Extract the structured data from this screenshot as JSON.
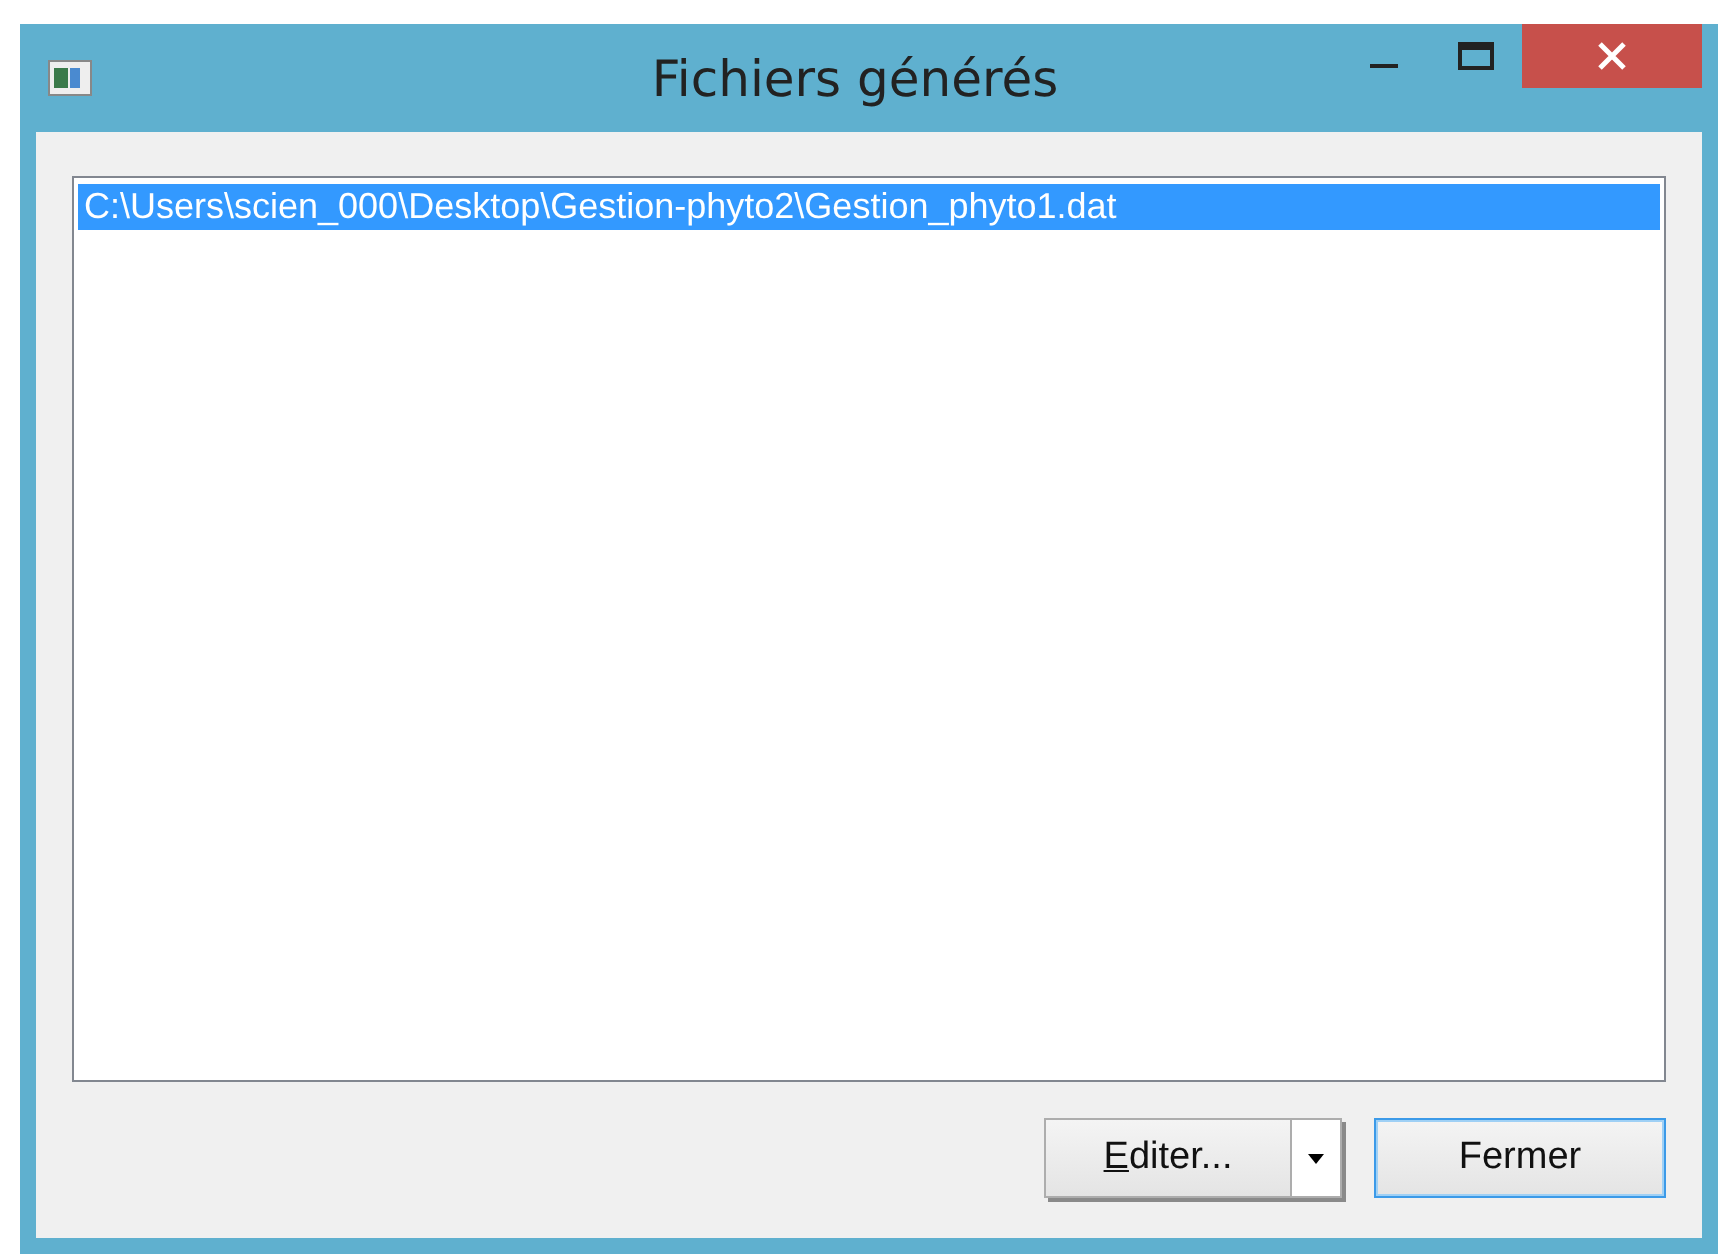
{
  "window": {
    "title": "Fichiers générés"
  },
  "files": [
    {
      "path": "C:\\Users\\scien_000\\Desktop\\Gestion-phyto2\\Gestion_phyto1.dat",
      "selected": true
    }
  ],
  "buttons": [
    {
      "kind": "split",
      "label": "Editer...",
      "default": false
    },
    {
      "kind": "plain",
      "label": "Fermer",
      "default": true
    }
  ]
}
